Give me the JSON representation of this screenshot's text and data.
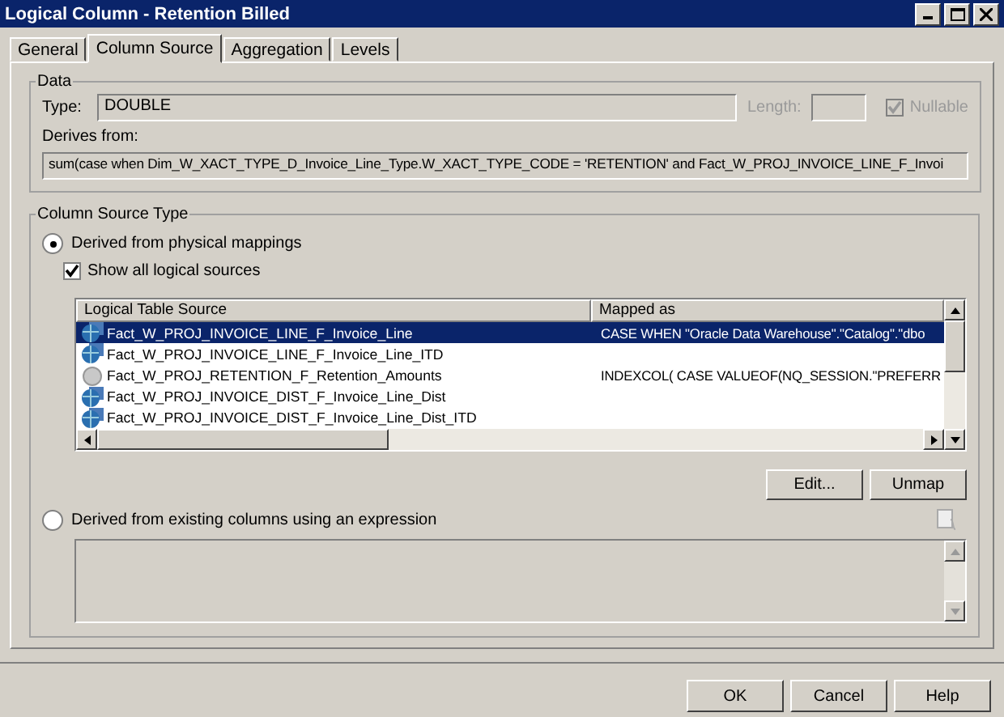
{
  "window": {
    "title": "Logical Column - Retention Billed"
  },
  "tabs": [
    {
      "label": "General",
      "selected": false
    },
    {
      "label": "Column Source",
      "selected": true
    },
    {
      "label": "Aggregation",
      "selected": false
    },
    {
      "label": "Levels",
      "selected": false
    }
  ],
  "data_group": {
    "title": "Data",
    "type_label": "Type:",
    "type_value": "DOUBLE",
    "length_label": "Length:",
    "nullable": {
      "label": "Nullable",
      "checked": true,
      "disabled": true
    },
    "derives_label": "Derives from:",
    "derives_value": "sum(case  when Dim_W_XACT_TYPE_D_Invoice_Line_Type.W_XACT_TYPE_CODE = 'RETENTION' and Fact_W_PROJ_INVOICE_LINE_F_Invoi"
  },
  "source_group": {
    "title": "Column Source Type",
    "physical": {
      "label": "Derived from physical mappings",
      "selected": true
    },
    "show_all": {
      "label": "Show all logical sources",
      "checked": true
    },
    "table": {
      "columns": [
        "Logical Table Source",
        "Mapped as"
      ],
      "rows": [
        {
          "source": "Fact_W_PROJ_INVOICE_LINE_F_Invoice_Line",
          "mapped": "CASE WHEN  \"Oracle Data Warehouse\".\"Catalog\".\"dbo",
          "selected": true,
          "active": true
        },
        {
          "source": "Fact_W_PROJ_INVOICE_LINE_F_Invoice_Line_ITD",
          "selected": false,
          "active": true
        },
        {
          "source": "Fact_W_PROJ_RETENTION_F_Retention_Amounts",
          "mapped": "INDEXCOL( CASE VALUEOF(NQ_SESSION.\"PREFERR",
          "selected": false,
          "active": false
        },
        {
          "source": "Fact_W_PROJ_INVOICE_DIST_F_Invoice_Line_Dist",
          "selected": false,
          "active": true
        },
        {
          "source": "Fact_W_PROJ_INVOICE_DIST_F_Invoice_Line_Dist_ITD",
          "selected": false,
          "active": true
        }
      ]
    },
    "buttons": [
      "Edit...",
      "Unmap"
    ],
    "expression": {
      "label": "Derived from existing columns using an expression",
      "selected": false
    }
  },
  "buttons": [
    "OK",
    "Cancel",
    "Help"
  ]
}
